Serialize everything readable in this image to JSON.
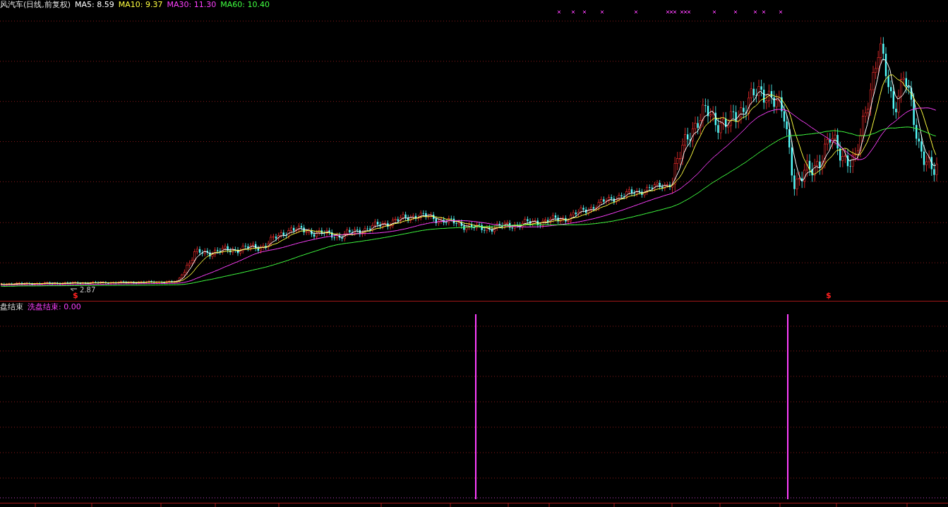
{
  "main_chart": {
    "title": "风汽车(日线,前复权)",
    "moving_averages": [
      {
        "text": "MA5: 8.59",
        "color": "#ffffff"
      },
      {
        "text": "MA10: 9.37",
        "color": "#ffff40"
      },
      {
        "text": "MA30: 11.30",
        "color": "#ff40ff"
      },
      {
        "text": "MA60: 10.40",
        "color": "#40ff40"
      }
    ],
    "low_label": "2.87",
    "signals": [
      "$",
      "$"
    ]
  },
  "indicator_panel": {
    "title": "盘结束",
    "series": [
      {
        "text": "洗盘结束: 0.00",
        "color": "#ff40ff"
      }
    ]
  }
}
